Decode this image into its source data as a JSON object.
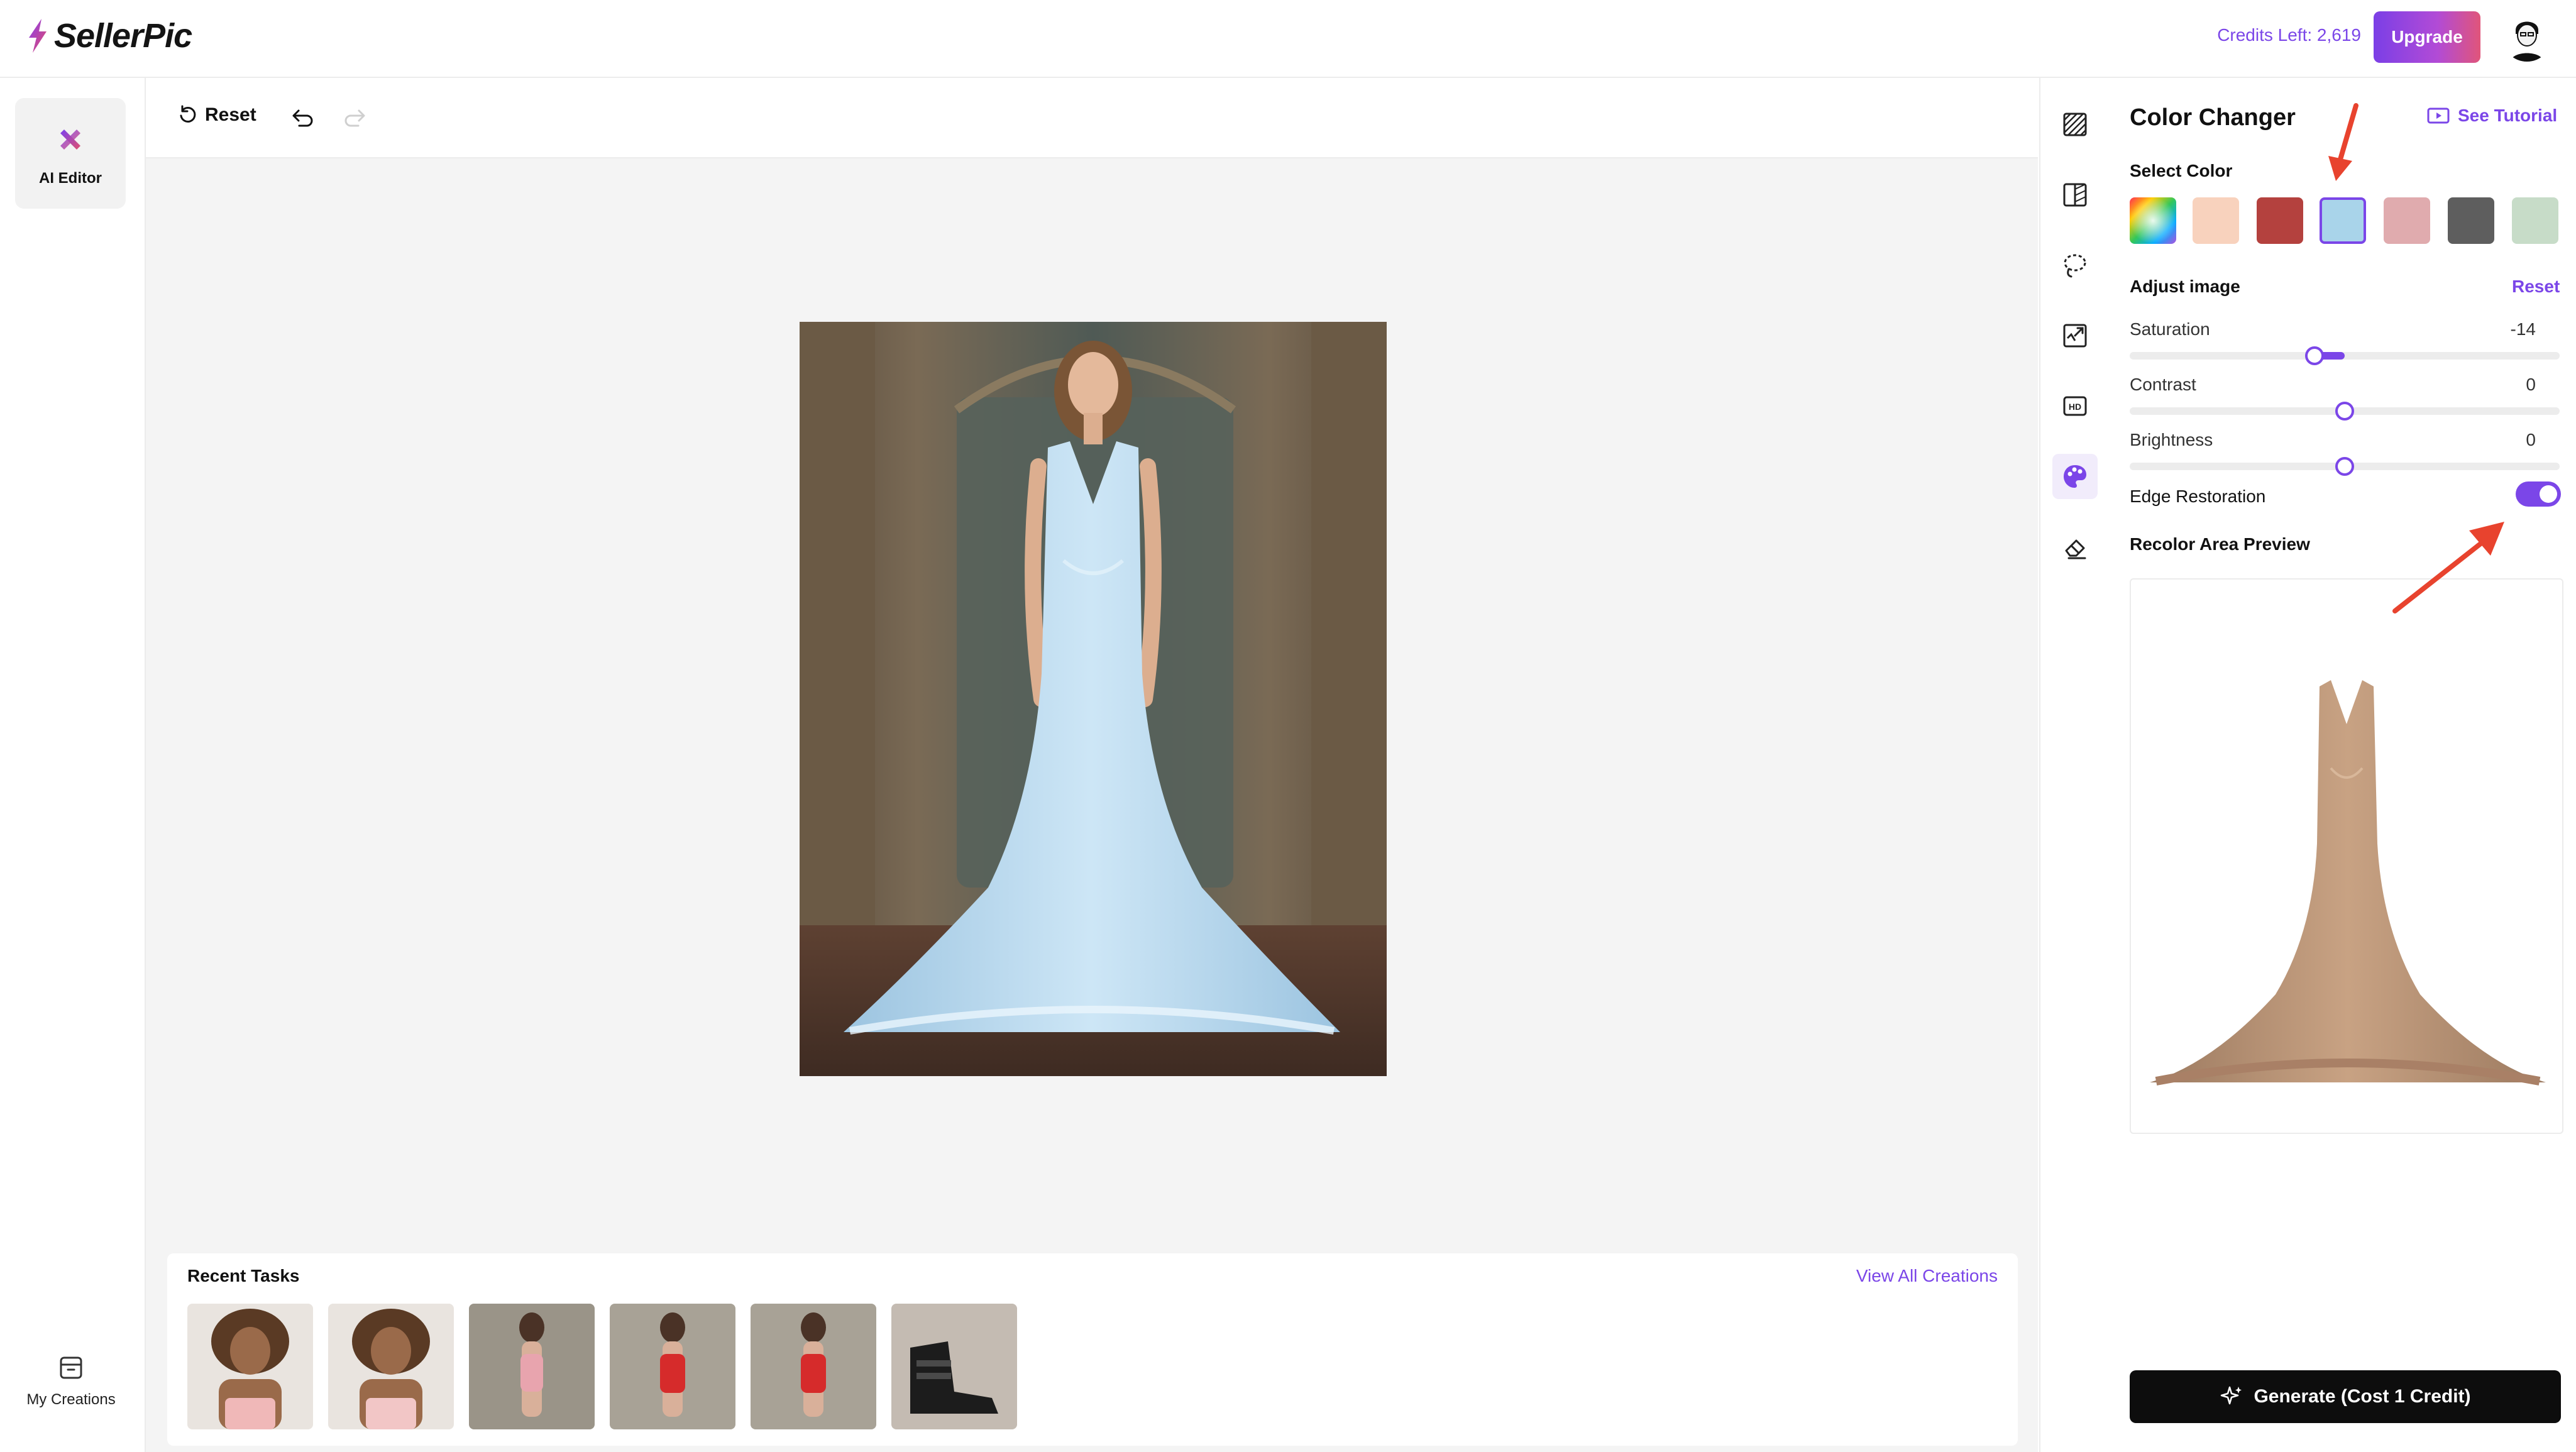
{
  "app": {
    "name": "SellerPic"
  },
  "header": {
    "credits": "Credits Left: 2,619",
    "upgrade_label": "Upgrade"
  },
  "left_nav": {
    "ai_editor": "AI Editor",
    "my_creations": "My Creations"
  },
  "toolbar": {
    "reset_label": "Reset"
  },
  "recent": {
    "title": "Recent Tasks",
    "view_all": "View All Creations"
  },
  "panel": {
    "title": "Color Changer",
    "tutorial": "See Tutorial",
    "select_color": "Select Color",
    "adjust_image": "Adjust image",
    "reset": "Reset",
    "saturation": {
      "label": "Saturation",
      "value": -14,
      "display": "-14"
    },
    "contrast": {
      "label": "Contrast",
      "value": 0,
      "display": "0"
    },
    "brightness": {
      "label": "Brightness",
      "value": 0,
      "display": "0"
    },
    "edge_restoration": {
      "label": "Edge Restoration",
      "enabled": true
    },
    "recolor_preview": "Recolor Area Preview",
    "generate": "Generate (Cost 1 Credit)"
  },
  "colors": {
    "accent": "#7b46e8",
    "swatches": [
      "#f8d2bd",
      "#b4413e",
      "#a9d4ea",
      "#e0abae",
      "#5e5e5e",
      "#c7dcc8"
    ],
    "selected_swatch": "#a9d4ea",
    "dress": "#b9daf0",
    "annotation_arrow": "#e8432e"
  }
}
